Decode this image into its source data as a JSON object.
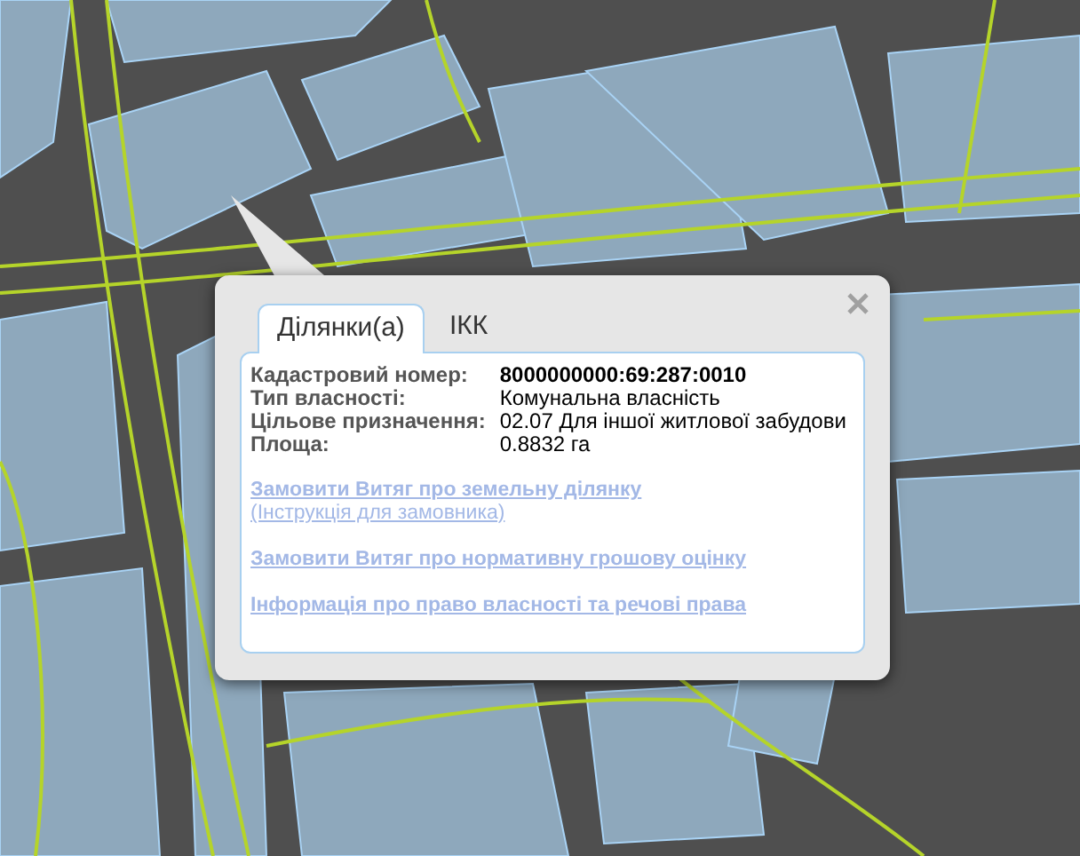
{
  "popup": {
    "tabs": [
      {
        "label": "Ділянки(а)",
        "selected": true
      },
      {
        "label": "ІКК",
        "selected": false
      }
    ],
    "info": [
      {
        "label": "Кадастровий номер:",
        "value": "8000000000:69:287:0010",
        "bold": true
      },
      {
        "label": "Тип власності:",
        "value": "Комунальна власність",
        "bold": false
      },
      {
        "label": "Цільове призначення:",
        "value": "02.07 Для іншої житлової забудови",
        "bold": false
      },
      {
        "label": "Площа:",
        "value": "0.8832 га",
        "bold": false
      }
    ],
    "link_groups": [
      {
        "links": [
          "Замовити Витяг про земельну ділянку",
          "(Інструкція для замовника)"
        ]
      },
      {
        "links": [
          "Замовити Витяг про нормативну грошову оцінку"
        ]
      },
      {
        "links": [
          "Інформація про право власності та речові права"
        ]
      }
    ]
  }
}
